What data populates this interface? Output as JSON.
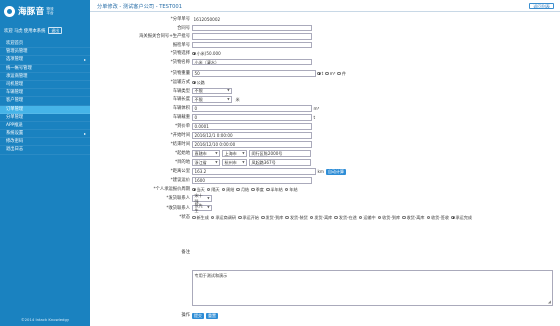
{
  "sidebar": {
    "logo_text": "海豚音",
    "logo_sub": "物流 平台",
    "user_greeting": "欢迎 马虎 使用本系统",
    "logout": "退出",
    "items": [
      {
        "label": "欢迎首页",
        "active": false,
        "expand": false
      },
      {
        "label": "管理员管理",
        "active": false,
        "expand": false
      },
      {
        "label": "选项管理",
        "active": false,
        "expand": true
      },
      {
        "label": "统一帐号管理",
        "active": false,
        "expand": false
      },
      {
        "label": "承运商管理",
        "active": false,
        "expand": false
      },
      {
        "label": "司机管理",
        "active": false,
        "expand": false
      },
      {
        "label": "车辆管理",
        "active": false,
        "expand": false
      },
      {
        "label": "客户管理",
        "active": false,
        "expand": false
      },
      {
        "label": "订单管理",
        "active": true,
        "expand": false
      },
      {
        "label": "分单管理",
        "active": false,
        "expand": false
      },
      {
        "label": "APP推送",
        "active": false,
        "expand": false
      },
      {
        "label": "系统设置",
        "active": false,
        "expand": true
      },
      {
        "label": "修改密码",
        "active": false,
        "expand": false
      },
      {
        "label": "退出日志",
        "active": false,
        "expand": false
      }
    ],
    "copyright": "©2014 Intack Knowledgy"
  },
  "header": {
    "title": "分单修改 - 测试客户公司 - TEST001",
    "back_button": "返回列表"
  },
  "form": {
    "order_no": {
      "label": "*分单单号",
      "value": "1612050002"
    },
    "contract_no": {
      "label": "合同号",
      "value": ""
    },
    "customs_no": {
      "label": "海关报关合同号+生产批号",
      "value": ""
    },
    "inspection_no": {
      "label": "报检单号",
      "value": ""
    },
    "goods_select": {
      "label": "*货物选择",
      "value": "小米(50.000"
    },
    "goods_name": {
      "label": "*货物名称",
      "value": "小米（凄水）"
    },
    "goods_weight": {
      "label": "*货物重量",
      "value": "50",
      "unit_t": "t",
      "unit_m3": "m³",
      "unit_pc": "件"
    },
    "transport": {
      "label": "*运输方式",
      "value": "公路"
    },
    "vehicle_type": {
      "label": "车辆类型",
      "value": "不限"
    },
    "vehicle_length": {
      "label": "车辆长度",
      "value": "不限",
      "unit": "米"
    },
    "vehicle_volume": {
      "label": "车辆体积",
      "value": "0",
      "unit": "m³"
    },
    "vehicle_load": {
      "label": "车辆载重",
      "value": "0",
      "unit": "t"
    },
    "price": {
      "label": "*到价单",
      "value": "0.0001"
    },
    "start_time": {
      "label": "*开始时间",
      "value": "2016/12/1 0:00:00"
    },
    "end_time": {
      "label": "*结束时间",
      "value": "2016/12/10 0:00:00"
    },
    "origin": {
      "label": "*起始地",
      "province": "直辖市",
      "city": "上海市",
      "detail": "闵行区陈2000号"
    },
    "destination": {
      "label": "*目的地",
      "province": "浙江省",
      "city": "杭州市",
      "detail": "凤起路367号"
    },
    "distance": {
      "label": "*距离公里",
      "value": "163.2",
      "unit": "km",
      "button": "自动计算"
    },
    "suggested_freight": {
      "label": "*建议运价",
      "value": "1600"
    },
    "bid_period": {
      "label": "*个人承运报价周期",
      "options": [
        {
          "label": "当天",
          "checked": true
        },
        {
          "label": "隔天",
          "checked": false
        },
        {
          "label": "周结",
          "checked": false
        },
        {
          "label": "月结",
          "checked": false
        },
        {
          "label": "季度",
          "checked": false
        },
        {
          "label": "半年结",
          "checked": false
        },
        {
          "label": "年结",
          "checked": false
        }
      ]
    },
    "shipper_contact": {
      "label": "*发货联系人",
      "value": "宋十强"
    },
    "receiver_contact": {
      "label": "*收货联系人",
      "value": "张先生"
    },
    "status": {
      "label": "*状态",
      "options": [
        {
          "label": "新生成",
          "checked": false
        },
        {
          "label": "承运商调研",
          "checked": false
        },
        {
          "label": "承运开始",
          "checked": false
        },
        {
          "label": "发货-到库",
          "checked": false
        },
        {
          "label": "发货-装货",
          "checked": false
        },
        {
          "label": "发货-离库",
          "checked": false
        },
        {
          "label": "发货-在途",
          "checked": false
        },
        {
          "label": "运输中",
          "checked": false
        },
        {
          "label": "收货-到库",
          "checked": false
        },
        {
          "label": "收货-离库",
          "checked": false
        },
        {
          "label": "收货-签收",
          "checked": false
        },
        {
          "label": "承运完成",
          "checked": true
        }
      ]
    },
    "remarks": {
      "label": "备注",
      "value": "专用于测试和演示"
    },
    "actions": {
      "label": "操作",
      "submit": "提交",
      "reset": "重置"
    }
  },
  "colors": {
    "sidebar": "#1a82c0",
    "active": "#46b4e8",
    "button": "#2e8dd6"
  }
}
